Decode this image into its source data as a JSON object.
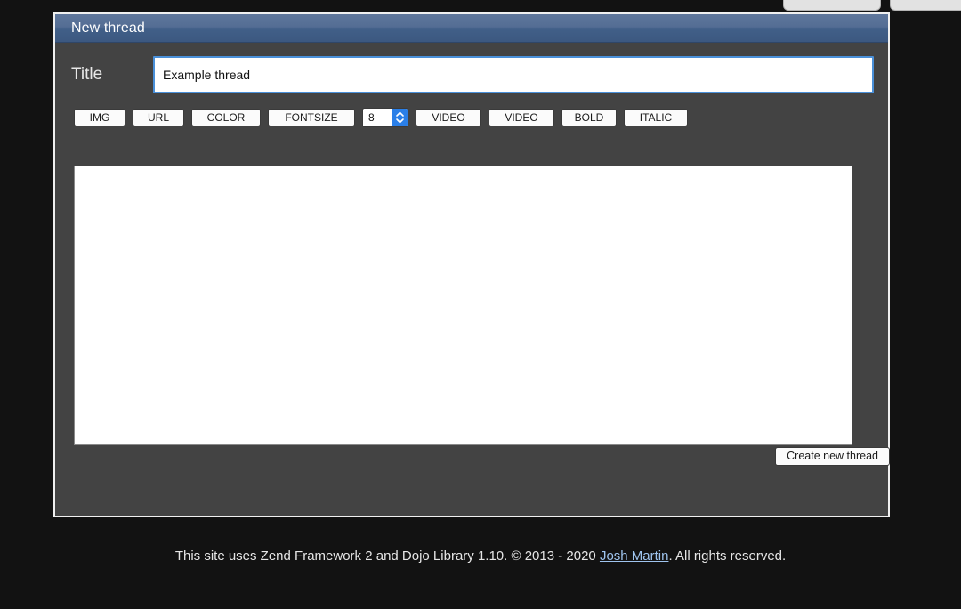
{
  "page": {
    "background_color": "#121212",
    "panel_background": "#434343",
    "accent_blue": "#4a90d9",
    "header_gradient_top": "#5f779c",
    "header_gradient_bottom": "#3c5880"
  },
  "top_bar": {
    "stub_1_label": "",
    "stub_2_label": ""
  },
  "panel": {
    "header_title": "New thread"
  },
  "form": {
    "title_label": "Title",
    "title_value": "Example thread",
    "title_placeholder": "",
    "editor_value": "",
    "editor_placeholder": "",
    "submit_label": "Create new thread"
  },
  "toolbar": {
    "buttons": [
      {
        "label": "IMG",
        "name": "img-button"
      },
      {
        "label": "URL",
        "name": "url-button"
      },
      {
        "label": "COLOR",
        "name": "color-button"
      },
      {
        "label": "FONTSIZE",
        "name": "fontsize-button"
      }
    ],
    "fontsize_value": "8",
    "buttons_right": [
      {
        "label": "VIDEO",
        "name": "video-button-1"
      },
      {
        "label": "VIDEO",
        "name": "video-button-2"
      },
      {
        "label": "BOLD",
        "name": "bold-button"
      },
      {
        "label": "ITALIC",
        "name": "italic-button"
      }
    ]
  },
  "footer": {
    "text_before": "This site uses Zend Framework 2 and Dojo Library 1.10. © 2013 - 2020 ",
    "link_text": "Josh Martin",
    "text_after": ". All rights reserved."
  }
}
